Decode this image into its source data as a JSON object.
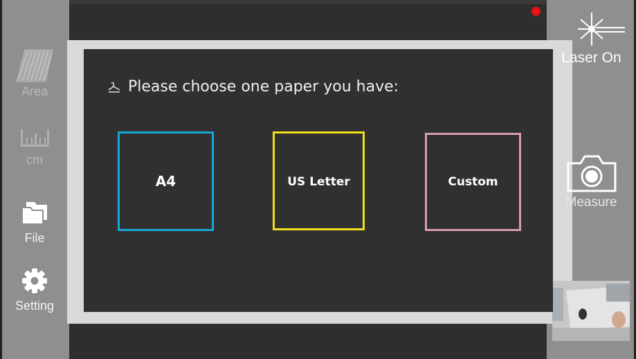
{
  "sidebar_left": {
    "items": [
      {
        "label": "Area",
        "icon": "area-icon"
      },
      {
        "label": "cm",
        "icon": "ruler-icon"
      },
      {
        "label": "File",
        "icon": "folder-icon"
      },
      {
        "label": "Setting",
        "icon": "gear-icon"
      }
    ]
  },
  "sidebar_right": {
    "laser_label": "Laser On",
    "measure_label": "Measure",
    "laser_icon": "laser-icon",
    "measure_icon": "camera-icon"
  },
  "dialog": {
    "title": "Please choose one paper you have:",
    "options": [
      {
        "label": "A4",
        "color": "#16a7d9"
      },
      {
        "label": "US Letter",
        "color": "#efe11b"
      },
      {
        "label": "Custom",
        "color": "#d99ab3"
      }
    ]
  },
  "status": {
    "recording_color": "#ee1111"
  }
}
